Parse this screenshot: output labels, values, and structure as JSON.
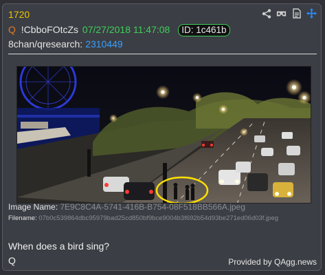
{
  "post": {
    "number": "1720",
    "author_marker": "Q",
    "tripcode": "!CbboFOtcZs",
    "datetime": "07/27/2018 11:47:08",
    "id_badge": "ID: 1c461b",
    "board": "8chan/qresearch:",
    "post_id": "2310449"
  },
  "toolbar": {
    "icons": [
      "share-icon",
      "vr-glasses-icon",
      "document-icon",
      "move-arrows-icon"
    ]
  },
  "image": {
    "name_label": "Image Name:",
    "name_value": "7E9C8C4A-5741-416B-B754-08F518BB566A.jpeg",
    "file_label": "Filename:",
    "file_value": "07b0c539864dbc95979bad25cd850bf9bce9004b3f692b54d93be271ed06d03f.jpeg"
  },
  "message": {
    "line1": "When does a bird sing?",
    "signature": "Q"
  },
  "footer": {
    "credit": "Provided by QAgg.news"
  },
  "colors": {
    "number": "#f0c400",
    "date": "#3ecf5a",
    "link": "#3aa0ff",
    "q_marker": "#e07b2a",
    "toolbar_move": "#2a8cff"
  }
}
